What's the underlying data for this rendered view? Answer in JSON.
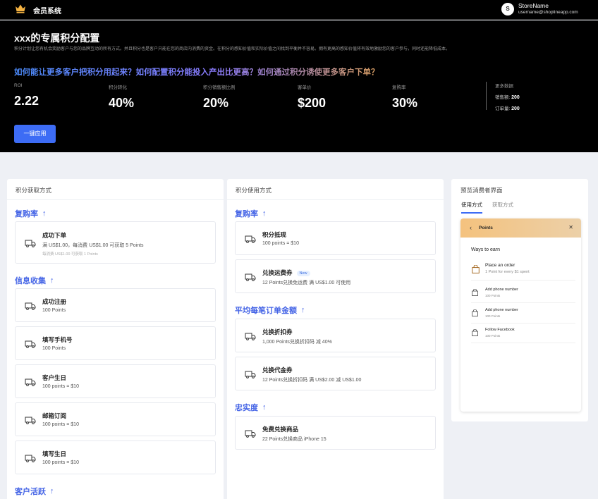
{
  "app": {
    "title": "会员系统",
    "logo_icon": "crown-icon"
  },
  "account": {
    "avatar_letter": "S",
    "store_name": "StoreName",
    "email": "username@shoplineapp.com"
  },
  "hero": {
    "title": "xxx的专属积分配置",
    "description": "积分计划让您有机会奖励客户与您的品牌互动的所有方式。并且积分也是客户只能在您的商店内消费的资金。在积分的感知价值和实际价值之间找到平衡并不容易。拥有更高的感知价值将有效地激励您的客户参与，同时还能降低成本。",
    "question": "如何能让更多客户把积分用起来？如何配置积分能投入产出比更高？如何通过积分诱使更多客户下单？",
    "metrics": [
      {
        "label": "ROI",
        "value": "2.22"
      },
      {
        "label": "积分转化",
        "value": "40%"
      },
      {
        "label": "积分销售额比例",
        "value": "20%"
      },
      {
        "label": "客单价",
        "value": "$200"
      },
      {
        "label": "复购率",
        "value": "30%"
      }
    ],
    "more_data": {
      "title": "更多数据",
      "rows": [
        {
          "label": "销售额:",
          "value": "200"
        },
        {
          "label": "订单量:",
          "value": "200"
        }
      ]
    },
    "apply_button": "一键应用"
  },
  "earn_panel": {
    "title": "积分获取方式",
    "groups": [
      {
        "title": "复购率",
        "cards": [
          {
            "title": "成功下单",
            "sub": "满 US$1.00，每消费 US$1.00 可获取 5 Points",
            "sub2": "每消费 US$1.00 可获取 1 Points"
          }
        ]
      },
      {
        "title": "信息收集",
        "cards": [
          {
            "title": "成功注册",
            "sub": "100 Points"
          },
          {
            "title": "填写手机号",
            "sub": "100 Points"
          },
          {
            "title": "客户生日",
            "sub": "100 points = $10"
          },
          {
            "title": "邮箱订阅",
            "sub": "100 points = $10"
          },
          {
            "title": "填写生日",
            "sub": "100 points = $10"
          }
        ]
      },
      {
        "title": "客户活跃",
        "cards": []
      }
    ]
  },
  "use_panel": {
    "title": "积分使用方式",
    "groups": [
      {
        "title": "复购率",
        "cards": [
          {
            "title": "积分抵现",
            "sub": "100 points = $10"
          },
          {
            "title": "兑换运费券",
            "badge": "New",
            "sub": "12 Points兑换免运费 满 US$1.00 可使用"
          }
        ]
      },
      {
        "title": "平均每笔订单金额",
        "cards": [
          {
            "title": "兑换折扣券",
            "sub": "1,000 Points兑换折扣码 减 40%"
          },
          {
            "title": "兑换代金券",
            "sub": "12 Points兑换折扣码 满 US$2.00 减 US$1.00"
          }
        ]
      },
      {
        "title": "忠实度",
        "cards": [
          {
            "title": "免费兑换商品",
            "sub": "22 Points兑换商品 iPhone 15"
          }
        ]
      }
    ]
  },
  "preview_panel": {
    "title": "预览消费者界面",
    "tabs": [
      {
        "label": "使用方式",
        "active": true
      },
      {
        "label": "获取方式",
        "active": false
      }
    ],
    "phone": {
      "header_title": "Points",
      "section_title": "Ways to earn",
      "items": [
        {
          "title": "Place an order",
          "sub": "1 Point for every $1 spent"
        },
        {
          "title": "Add phone number",
          "sub": "100 Points"
        },
        {
          "title": "Add phone number",
          "sub": "100 Points"
        },
        {
          "title": "Follow Facebook",
          "sub": "100 Points"
        }
      ]
    }
  },
  "colors": {
    "accent": "#3d6cf5",
    "group_title": "#4363e6",
    "hero_bg": "#000000",
    "page_bg": "#eef0f5"
  }
}
